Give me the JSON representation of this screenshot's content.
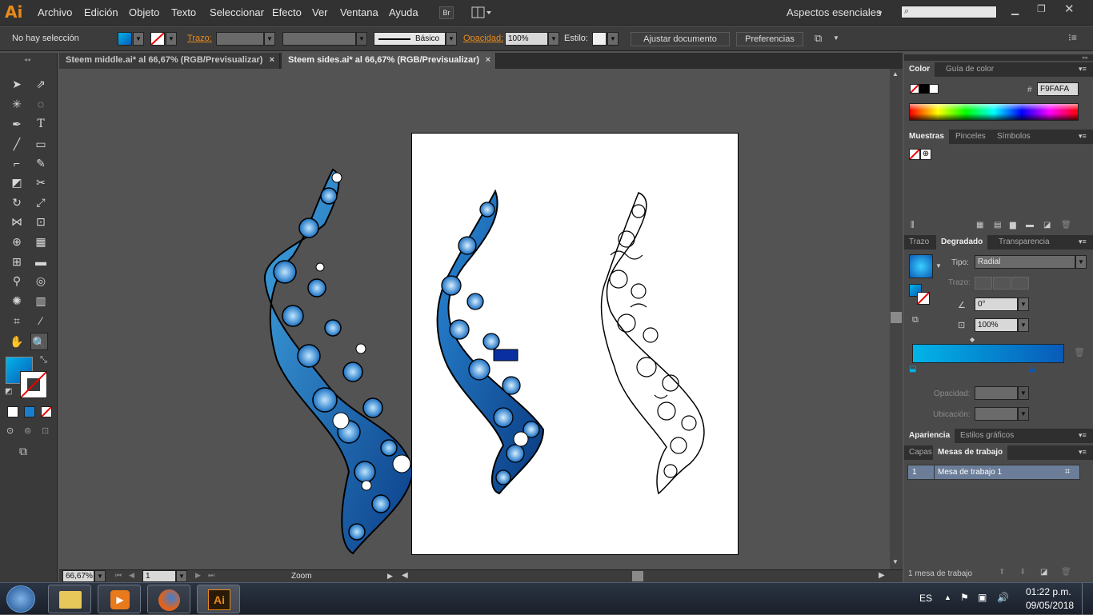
{
  "app": {
    "logo": "Ai",
    "menu": [
      "Archivo",
      "Edición",
      "Objeto",
      "Texto",
      "Seleccionar",
      "Efecto",
      "Ver",
      "Ventana",
      "Ayuda"
    ],
    "bridge_label": "Br",
    "workspace": "Aspectos esenciales",
    "search_placeholder": ""
  },
  "controlbar": {
    "selection": "No hay selección",
    "stroke_label": "Trazo:",
    "brush_label": "Básico",
    "opacity_label": "Opacidad:",
    "opacity_value": "100%",
    "style_label": "Estilo:",
    "adjust_button": "Ajustar documento",
    "prefs_button": "Preferencias"
  },
  "tabs": [
    {
      "label": "Steem middle.ai* al 66,67% (RGB/Previsualizar)",
      "close": "×"
    },
    {
      "label": "Steem sides.ai* al 66,67% (RGB/Previsualizar)",
      "close": "×"
    }
  ],
  "statusbar": {
    "zoom": "66,67%",
    "artboard_num": "1",
    "tool": "Zoom"
  },
  "panels": {
    "color_tab": "Color",
    "color_guide_tab": "Guía de color",
    "hex_symbol": "#",
    "hex_value": "F9FAFA",
    "swatches_tab": "Muestras",
    "brushes_tab": "Pinceles",
    "symbols_tab": "Símbolos",
    "stroke_tab": "Trazo",
    "gradient_tab": "Degradado",
    "transparency_tab": "Transparencia",
    "type_label": "Tipo:",
    "type_value": "Radial",
    "stroke_label": "Trazo:",
    "angle_value": "0°",
    "ratio_value": "100%",
    "opacity_label": "Opacidad:",
    "location_label": "Ubicación:",
    "appearance_tab": "Apariencia",
    "graphic_styles_tab": "Estilos gráficos",
    "layers_tab": "Capas",
    "artboards_tab": "Mesas de trabajo",
    "artboard_row_num": "1",
    "artboard_row_name": "Mesa de trabajo 1",
    "artboard_count": "1 mesa de trabajo"
  },
  "taskbar": {
    "language": "ES",
    "time": "01:22 p.m.",
    "date": "09/05/2018",
    "ai_label": "Ai"
  },
  "colors": {
    "accent_orange": "#e88a1a",
    "gradient_start": "#00b4e8",
    "gradient_end": "#0a5ab8"
  }
}
